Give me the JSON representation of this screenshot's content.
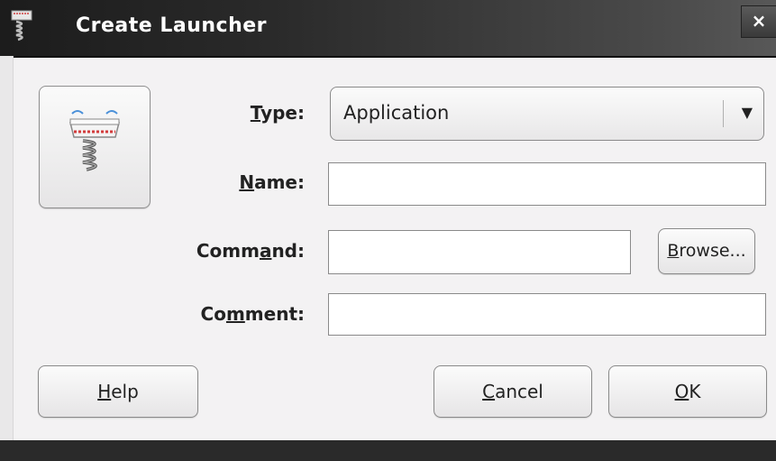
{
  "window": {
    "title": "Create Launcher",
    "close_label": "×"
  },
  "icons": {
    "app_icon": "launcher-spring-icon",
    "launcher_icon": "launcher-spring-icon"
  },
  "form": {
    "type": {
      "label_mnemonic": "T",
      "label_rest": "ype:",
      "selected_value": "Application",
      "arrow": "▼"
    },
    "name": {
      "label_mnemonic": "N",
      "label_rest": "ame:",
      "value": ""
    },
    "command": {
      "label_pre": "Comm",
      "label_mnemonic": "a",
      "label_rest": "nd:",
      "value": "",
      "browse_mnemonic": "B",
      "browse_rest": "rowse..."
    },
    "comment": {
      "label_pre": "Co",
      "label_mnemonic": "m",
      "label_rest": "ment:",
      "value": ""
    }
  },
  "buttons": {
    "help_mnemonic": "H",
    "help_rest": "elp",
    "cancel_mnemonic": "C",
    "cancel_rest": "ancel",
    "ok_mnemonic": "O",
    "ok_rest": "K"
  }
}
